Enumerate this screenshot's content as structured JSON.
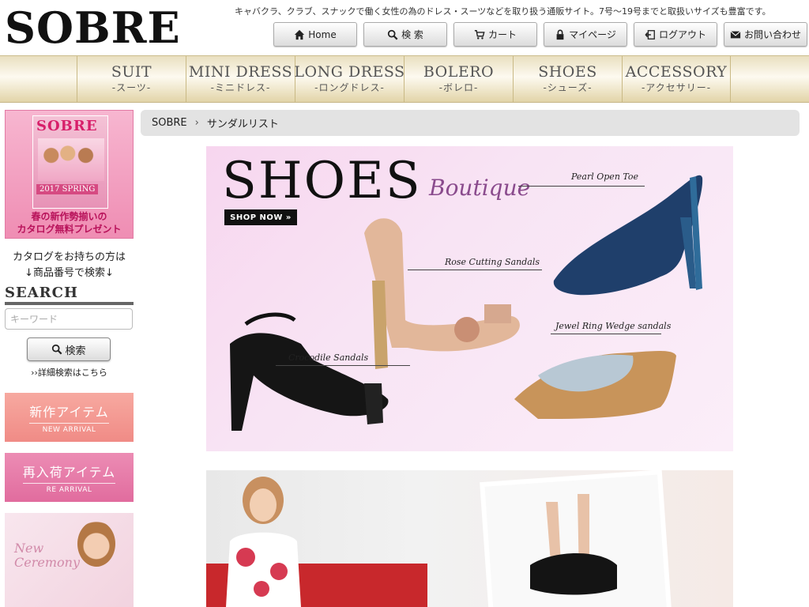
{
  "header": {
    "logo": "SOBRE",
    "tagline": "キャバクラ、クラブ、スナックで働く女性の為のドレス・スーツなどを取り扱う通販サイト。7号〜19号までと取扱いサイズも豊富です。",
    "nav": [
      {
        "label": "Home",
        "icon": "home-icon"
      },
      {
        "label": "検 索",
        "icon": "search-icon"
      },
      {
        "label": "カート",
        "icon": "cart-icon"
      },
      {
        "label": "マイページ",
        "icon": "lock-icon"
      },
      {
        "label": "ログアウト",
        "icon": "logout-icon"
      },
      {
        "label": "お問い合わせ",
        "icon": "mail-icon"
      }
    ]
  },
  "categories": [
    {
      "en": "SUIT",
      "jp": "-スーツ-"
    },
    {
      "en": "MINI DRESS",
      "jp": "-ミニドレス-"
    },
    {
      "en": "LONG DRESS",
      "jp": "-ロングドレス-"
    },
    {
      "en": "BOLERO",
      "jp": "-ボレロ-"
    },
    {
      "en": "SHOES",
      "jp": "-シューズ-"
    },
    {
      "en": "ACCESSORY",
      "jp": "-アクセサリー-"
    }
  ],
  "sidebar": {
    "catalog": {
      "book_title": "SOBRE",
      "season": "2017 SPRING",
      "caption_line1": "春の新作勢揃いの",
      "caption_line2": "カタログ無料プレゼント"
    },
    "catalog_text_line1": "カタログをお持ちの方は",
    "catalog_text_line2": "↓商品番号で検索↓",
    "search_heading": "SEARCH",
    "search_placeholder": "キーワード",
    "search_button": "検索",
    "advanced_link": "››詳細検索はこちら",
    "banners": [
      {
        "jp": "新作アイテム",
        "en": "NEW ARRIVAL"
      },
      {
        "jp": "再入荷アイテム",
        "en": "RE ARRIVAL"
      }
    ],
    "ceremony": {
      "title_line1": "New",
      "title_line2": "Ceremony"
    }
  },
  "breadcrumb": {
    "home": "SOBRE",
    "current": "サンダルリスト"
  },
  "hero": {
    "title": "SHOES",
    "subtitle": "Boutique",
    "shop_now": "SHOP NOW »",
    "labels": {
      "pearl": "Pearl Open Toe",
      "rose": "Rose Cutting Sandals",
      "jewel": "Jewel Ring Wedge sandals",
      "croc": "Crocodile Sandals"
    }
  },
  "colors": {
    "accent_gold": "#e2d4a8",
    "new_banner": "#f08b86",
    "re_banner": "#e16c9e",
    "hero_bg": "#f7d6ef"
  }
}
